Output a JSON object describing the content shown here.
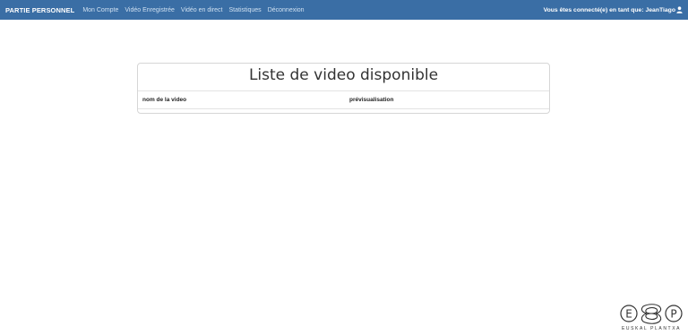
{
  "navbar": {
    "brand": "PARTIE PERSONNEL",
    "links": [
      "Mon Compte",
      "Vidéo Enregistrée",
      "Vidéo en direct",
      "Statistiques",
      "Déconnexion"
    ],
    "user_text": "Vous êtes connecté(e) en tant que: JeanTiago",
    "user_icon": "user-icon"
  },
  "card": {
    "title": "Liste de video disponible",
    "columns": [
      "nom de la video",
      "prévisualisation"
    ]
  },
  "logo": {
    "text": "EUSKAL PLANTXA",
    "letters": [
      "E",
      "P"
    ]
  },
  "colors": {
    "navbar_bg": "#3a6ea5",
    "nav_link": "#cfe0f1",
    "brand_text": "#ffffff"
  }
}
